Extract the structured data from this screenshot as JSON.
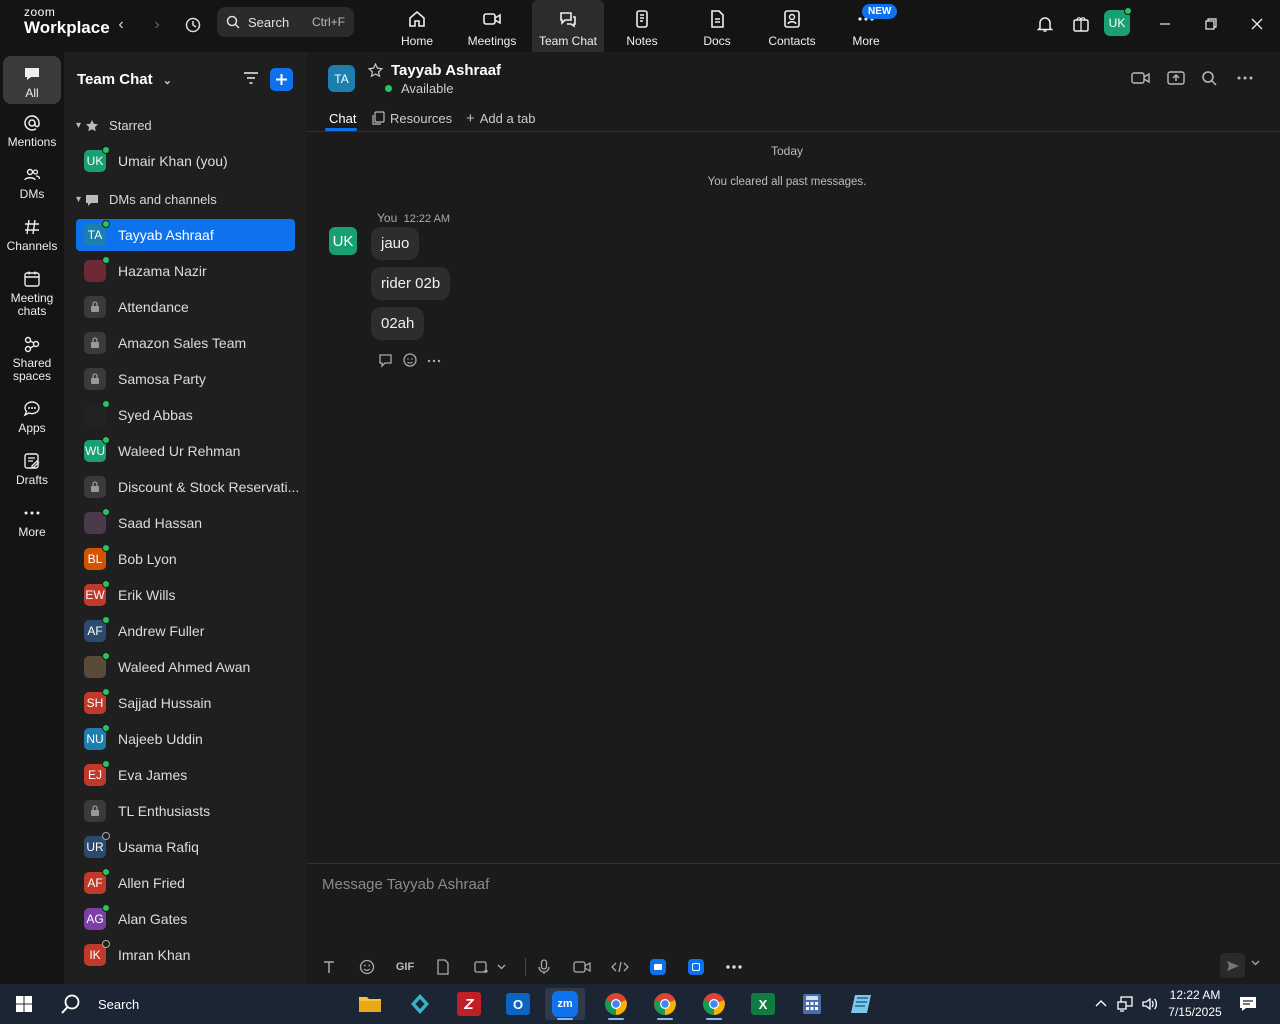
{
  "app": {
    "brand_top": "zoom",
    "brand_bottom": "Workplace"
  },
  "search": {
    "label": "Search",
    "shortcut": "Ctrl+F"
  },
  "top_nav": [
    {
      "label": "Home"
    },
    {
      "label": "Meetings"
    },
    {
      "label": "Team Chat"
    },
    {
      "label": "Notes"
    },
    {
      "label": "Docs"
    },
    {
      "label": "Contacts"
    },
    {
      "label": "More"
    }
  ],
  "new_badge": "NEW",
  "user_avatar": "UK",
  "left_rail": [
    {
      "label": "All"
    },
    {
      "label": "Mentions"
    },
    {
      "label": "DMs"
    },
    {
      "label": "Channels"
    },
    {
      "label": "Meeting chats"
    },
    {
      "label": "Shared spaces"
    },
    {
      "label": "Apps"
    },
    {
      "label": "Drafts"
    },
    {
      "label": "More"
    }
  ],
  "sidebar": {
    "title": "Team Chat",
    "starred_label": "Starred",
    "dms_label": "DMs and channels",
    "starred": [
      {
        "initials": "UK",
        "name": "Umair Khan (you)",
        "color": "#18a071"
      }
    ],
    "items": [
      {
        "initials": "TA",
        "name": "Tayyab Ashraaf",
        "color": "#1c7fb0"
      },
      {
        "initials": "",
        "name": "Hazama Nazir",
        "color": "#6b2a35"
      },
      {
        "initials": "",
        "name": "Attendance",
        "color": "#3a3a3a"
      },
      {
        "initials": "",
        "name": "Amazon Sales Team",
        "color": "#3a3a3a"
      },
      {
        "initials": "",
        "name": "Samosa Party",
        "color": "#3a3a3a"
      },
      {
        "initials": "",
        "name": "Syed Abbas",
        "color": "#222222"
      },
      {
        "initials": "WU",
        "name": "Waleed Ur Rehman",
        "color": "#18a071"
      },
      {
        "initials": "",
        "name": "Discount & Stock Reservati...",
        "color": "#3a3a3a"
      },
      {
        "initials": "",
        "name": "Saad Hassan",
        "color": "#4a3a4a"
      },
      {
        "initials": "BL",
        "name": "Bob Lyon",
        "color": "#d35400"
      },
      {
        "initials": "EW",
        "name": "Erik Wills",
        "color": "#c0392b"
      },
      {
        "initials": "AF",
        "name": "Andrew Fuller",
        "color": "#2c4a6e"
      },
      {
        "initials": "",
        "name": "Waleed Ahmed Awan",
        "color": "#5a4a3a"
      },
      {
        "initials": "SH",
        "name": "Sajjad Hussain",
        "color": "#c0392b"
      },
      {
        "initials": "NU",
        "name": "Najeeb Uddin",
        "color": "#1c7fb0"
      },
      {
        "initials": "EJ",
        "name": "Eva James",
        "color": "#c0392b"
      },
      {
        "initials": "",
        "name": "TL Enthusiasts",
        "color": "#3a3a3a"
      },
      {
        "initials": "UR",
        "name": "Usama Rafiq",
        "color": "#2c4a6e"
      },
      {
        "initials": "AF",
        "name": "Allen Fried",
        "color": "#c0392b"
      },
      {
        "initials": "AG",
        "name": "Alan Gates",
        "color": "#7b3fa6"
      },
      {
        "initials": "IK",
        "name": "Imran Khan",
        "color": "#c0392b"
      }
    ]
  },
  "chat": {
    "avatar": "TA",
    "name": "Tayyab Ashraaf",
    "status": "Available",
    "tabs": {
      "chat": "Chat",
      "resources": "Resources",
      "add": "Add a tab"
    },
    "day_label": "Today",
    "cleared_notice": "You cleared all past messages.",
    "sender": "You",
    "time": "12:22 AM",
    "sender_avatar": "UK",
    "messages": [
      "jauo",
      "rider 02b",
      "02ah"
    ]
  },
  "composer": {
    "placeholder": "Message Tayyab Ashraaf",
    "gif_label": "GIF"
  },
  "taskbar": {
    "search_label": "Search",
    "time": "12:22 AM",
    "date": "7/15/2025"
  }
}
